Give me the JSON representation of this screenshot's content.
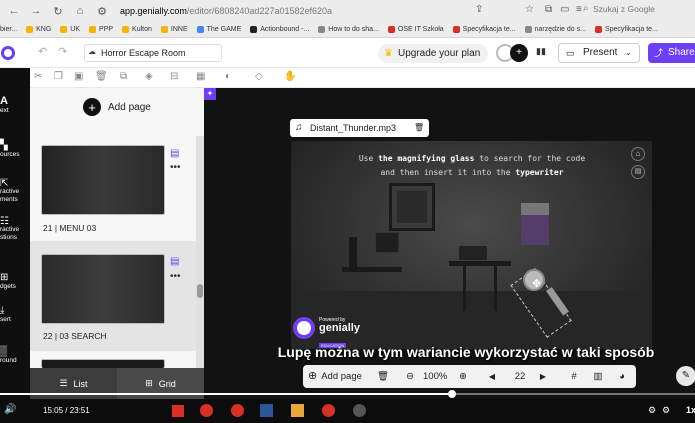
{
  "browser": {
    "url_domain": "app.genially.com",
    "url_path": "/editor/6808240ad227a01582ef620a",
    "search_placeholder": "Szukaj z Google",
    "bookmarks": [
      "KNG",
      "UK",
      "PPP",
      "Kulton",
      "INNE",
      "The GAME",
      "Actionbound -...",
      "How to do sha...",
      "OSE IT Szkoła",
      "Specyfikacja te...",
      "narzędzie do s...",
      "Specyfikacja te..."
    ],
    "left_fragment": "bier..."
  },
  "editor": {
    "title": "Horror Escape Room",
    "upgrade_label": "Upgrade your plan",
    "present_label": "Present",
    "share_label": "Share",
    "tools": [
      "ext",
      "ources",
      "ractive\nments",
      "ractive\nstions",
      "dgets",
      "sert",
      "round"
    ]
  },
  "pages": {
    "add_page_label": "Add page",
    "items": [
      {
        "label": "21 |  MENU 03"
      },
      {
        "label": "22 |  03 SEARCH"
      }
    ],
    "list_label": "List",
    "grid_label": "Grid"
  },
  "canvas": {
    "audio_name": "Distant_Thunder.mp3",
    "instruction_line1_a": "Use ",
    "instruction_line1_b": "the magnifying glass",
    "instruction_line1_c": " to search for the code",
    "instruction_line2_a": "and then insert it into the ",
    "instruction_line2_b": "typewriter",
    "logo_small": "Powered by",
    "logo_brand": "genially",
    "logo_tag": "EDUCATION"
  },
  "bottombar": {
    "add_page": "Add page",
    "zoom": "100%",
    "page_number": "22"
  },
  "subtitle": "Lupę można w tym wariancie wykorzystać w taki sposób",
  "video": {
    "time": "15:05 / 23:51",
    "speed": "1x"
  },
  "colors": {
    "accent": "#6c3ff5",
    "bookmark_red": "#d93025"
  }
}
